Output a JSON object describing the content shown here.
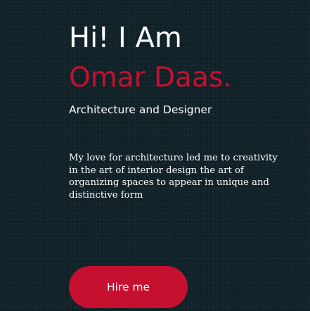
{
  "hero": {
    "greeting": "Hi! I Am",
    "name": "Omar Daas.",
    "subtitle": "Architecture and Designer",
    "bio": "My love for architecture led me to creativity in the art of interior design the art of organizing spaces to appear in unique and distinctive form",
    "hire_label": "Hire me"
  },
  "colors": {
    "background": "#0f2027",
    "accent": "#c5102f",
    "text": "#ffffff"
  }
}
